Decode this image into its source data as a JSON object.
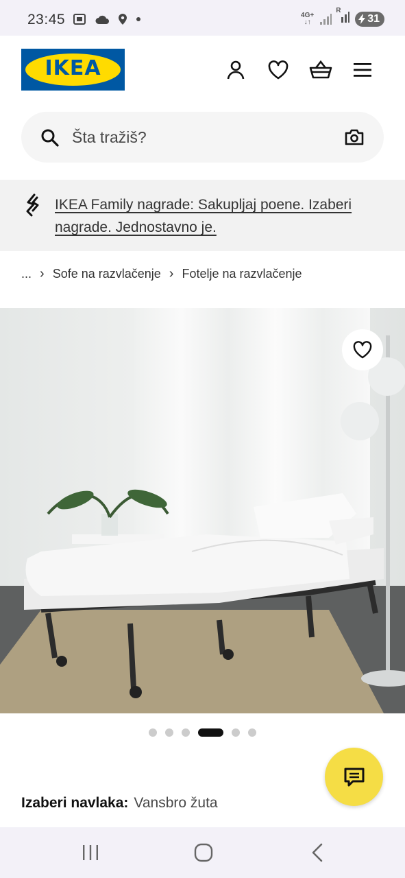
{
  "status_bar": {
    "time": "23:45",
    "network_type": "4G+",
    "sim_label": "R",
    "battery": "31"
  },
  "header": {
    "logo_text": "IKEA",
    "icons": [
      "account-icon",
      "heart-icon",
      "basket-icon",
      "menu-icon"
    ]
  },
  "search": {
    "placeholder": "Šta tražiš?"
  },
  "promo": {
    "text": "IKEA Family nagrade: Sakupljaj poene. Izaberi nagrade. Jednostavno je."
  },
  "breadcrumb": {
    "ellipsis": "...",
    "items": [
      "Sofe na razvlačenje",
      "Fotelje na razvlačenje"
    ]
  },
  "carousel": {
    "total": 6,
    "active": 4
  },
  "cover": {
    "label": "Izaberi navlaka:",
    "value": "Vansbro žuta"
  },
  "colors": {
    "brand_blue": "#0058a3",
    "brand_yellow": "#ffdb00",
    "chat_yellow": "#f5dd45"
  }
}
